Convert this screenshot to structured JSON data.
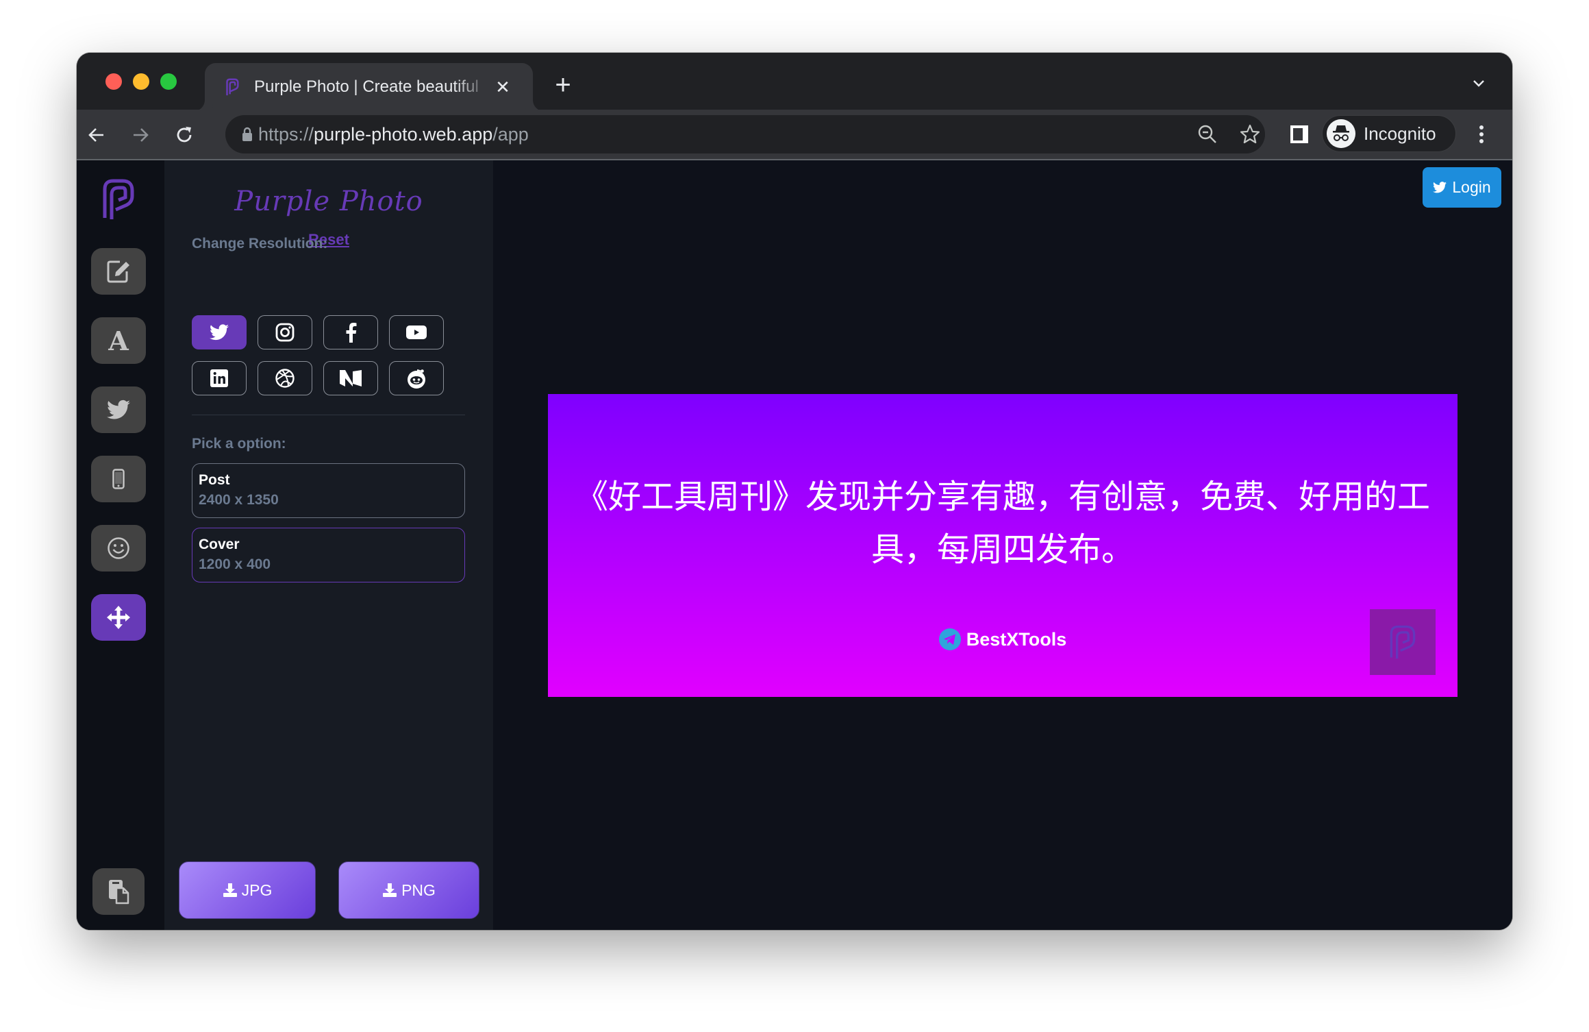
{
  "browser": {
    "tab_title": "Purple Photo | Create beautiful",
    "tab_close": "✕",
    "new_tab": "+",
    "url_scheme": "https://",
    "url_host": "purple-photo.web.app",
    "url_path": "/app",
    "profile_label": "Incognito"
  },
  "colors": {
    "accent": "#673ab7",
    "login_blue": "#1d8ddc",
    "canvas_gradient_top": "#7f00ff",
    "canvas_gradient_bottom": "#e100ff"
  },
  "rail": {
    "items": [
      {
        "name": "edit",
        "icon": "edit-icon",
        "active": false
      },
      {
        "name": "font",
        "icon": "font-icon",
        "label": "A",
        "active": false
      },
      {
        "name": "twitter",
        "icon": "twitter-icon",
        "active": false
      },
      {
        "name": "mobile",
        "icon": "mobile-icon",
        "active": false
      },
      {
        "name": "emoji",
        "icon": "emoji-icon",
        "active": false
      },
      {
        "name": "move",
        "icon": "move-icon",
        "active": true
      }
    ],
    "bottom_item": {
      "name": "paste",
      "icon": "paste-icon"
    }
  },
  "panel": {
    "app_title": "Purple Photo",
    "reset_label": "Reset",
    "resolution_label": "Change Resolution:",
    "platforms": [
      {
        "name": "twitter",
        "active": true
      },
      {
        "name": "instagram",
        "active": false
      },
      {
        "name": "facebook",
        "active": false
      },
      {
        "name": "youtube",
        "active": false
      },
      {
        "name": "linkedin",
        "active": false
      },
      {
        "name": "dribbble",
        "active": false
      },
      {
        "name": "medium",
        "active": false
      },
      {
        "name": "reddit",
        "active": false
      }
    ],
    "option_label": "Pick a option:",
    "options": [
      {
        "name": "Post",
        "size": "2400 x 1350",
        "selected": false
      },
      {
        "name": "Cover",
        "size": "1200 x 400",
        "selected": true
      }
    ],
    "download_jpg": "JPG",
    "download_png": "PNG"
  },
  "main": {
    "login_label": "Login",
    "canvas": {
      "text": "《好工具周刊》发现并分享有趣，有创意，免费、好用的工具，每周四发布。",
      "brand_name": "BestXTools"
    }
  }
}
